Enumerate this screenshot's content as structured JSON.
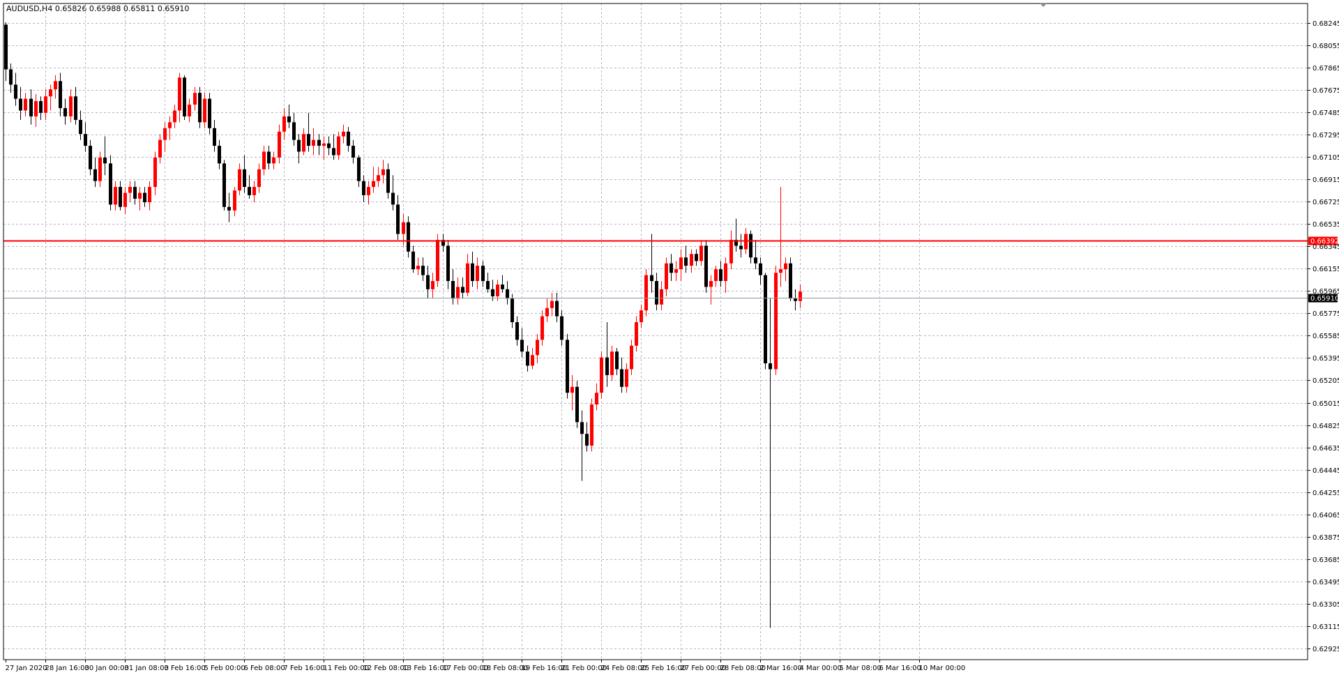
{
  "header": {
    "symbol": "AUDUSD,H4",
    "open": "0.65826",
    "high": "0.65988",
    "low": "0.65811",
    "close": "0.65910"
  },
  "colors": {
    "bull": "#ff0000",
    "bear": "#000000",
    "grid": "#b4b4c8",
    "level_line": "#ff0000",
    "bid_line": "#8c96a6"
  },
  "chart_data": {
    "type": "candlestick",
    "title": "AUDUSD,H4",
    "price_axis_ticks": [
      "0.68245",
      "0.68055",
      "0.67865",
      "0.67675",
      "0.67485",
      "0.67295",
      "0.67105",
      "0.66915",
      "0.66725",
      "0.66535",
      "0.66345",
      "0.66155",
      "0.65965",
      "0.65775",
      "0.65585",
      "0.65395",
      "0.65205",
      "0.65015",
      "0.64825",
      "0.64635",
      "0.64445",
      "0.64255",
      "0.64065",
      "0.63875",
      "0.63685",
      "0.63495",
      "0.63305",
      "0.63115",
      "0.62925"
    ],
    "time_axis_labels": [
      "27 Jan 2020",
      "28 Jan 16:00",
      "30 Jan 00:00",
      "31 Jan 08:00",
      "3 Feb 16:00",
      "5 Feb 00:00",
      "6 Feb 08:00",
      "7 Feb 16:00",
      "11 Feb 00:00",
      "12 Feb 08:00",
      "13 Feb 16:00",
      "17 Feb 00:00",
      "18 Feb 08:00",
      "19 Feb 16:00",
      "21 Feb 00:00",
      "24 Feb 08:00",
      "25 Feb 16:00",
      "27 Feb 00:00",
      "28 Feb 08:00",
      "2 Mar 16:00",
      "4 Mar 00:00",
      "5 Mar 08:00",
      "6 Mar 16:00",
      "10 Mar 00:00"
    ],
    "ylim": [
      0.6283,
      0.6841
    ],
    "horizontal_level": "0.66392",
    "bid_price": "0.65910",
    "grid": true,
    "candles": [
      [
        0.6823,
        0.6825,
        0.6775,
        0.6785
      ],
      [
        0.6785,
        0.679,
        0.6765,
        0.6772
      ],
      [
        0.6772,
        0.6782,
        0.6754,
        0.676
      ],
      [
        0.676,
        0.677,
        0.6742,
        0.675
      ],
      [
        0.675,
        0.6765,
        0.6745,
        0.676
      ],
      [
        0.676,
        0.6768,
        0.6738,
        0.6745
      ],
      [
        0.6745,
        0.6764,
        0.6736,
        0.6758
      ],
      [
        0.6758,
        0.6762,
        0.6742,
        0.6748
      ],
      [
        0.6748,
        0.6768,
        0.6742,
        0.6762
      ],
      [
        0.6762,
        0.6772,
        0.675,
        0.6768
      ],
      [
        0.6768,
        0.678,
        0.676,
        0.6775
      ],
      [
        0.6775,
        0.6782,
        0.6745,
        0.6752
      ],
      [
        0.6752,
        0.676,
        0.6738,
        0.6745
      ],
      [
        0.6745,
        0.6768,
        0.674,
        0.6762
      ],
      [
        0.6762,
        0.677,
        0.6738,
        0.6742
      ],
      [
        0.6742,
        0.675,
        0.6725,
        0.673
      ],
      [
        0.673,
        0.674,
        0.6715,
        0.672
      ],
      [
        0.672,
        0.6725,
        0.6695,
        0.67
      ],
      [
        0.67,
        0.671,
        0.6685,
        0.669
      ],
      [
        0.669,
        0.6715,
        0.6685,
        0.671
      ],
      [
        0.671,
        0.6728,
        0.6695,
        0.6705
      ],
      [
        0.6705,
        0.6712,
        0.6665,
        0.667
      ],
      [
        0.667,
        0.669,
        0.6665,
        0.6685
      ],
      [
        0.6685,
        0.669,
        0.6665,
        0.6668
      ],
      [
        0.6668,
        0.6685,
        0.6662,
        0.668
      ],
      [
        0.668,
        0.669,
        0.6672,
        0.6685
      ],
      [
        0.6685,
        0.669,
        0.667,
        0.6675
      ],
      [
        0.6675,
        0.6685,
        0.6665,
        0.668
      ],
      [
        0.668,
        0.6685,
        0.6668,
        0.6672
      ],
      [
        0.6672,
        0.669,
        0.6665,
        0.6685
      ],
      [
        0.6685,
        0.6715,
        0.6678,
        0.671
      ],
      [
        0.671,
        0.673,
        0.6705,
        0.6725
      ],
      [
        0.6725,
        0.674,
        0.6715,
        0.6735
      ],
      [
        0.6735,
        0.6745,
        0.6725,
        0.674
      ],
      [
        0.674,
        0.6755,
        0.6735,
        0.675
      ],
      [
        0.675,
        0.6782,
        0.674,
        0.6778
      ],
      [
        0.6778,
        0.678,
        0.6742,
        0.6745
      ],
      [
        0.6745,
        0.676,
        0.674,
        0.6755
      ],
      [
        0.6755,
        0.677,
        0.675,
        0.6765
      ],
      [
        0.6765,
        0.677,
        0.6735,
        0.674
      ],
      [
        0.674,
        0.6765,
        0.6735,
        0.676
      ],
      [
        0.676,
        0.6765,
        0.673,
        0.6735
      ],
      [
        0.6735,
        0.6742,
        0.6715,
        0.672
      ],
      [
        0.672,
        0.6725,
        0.67,
        0.6705
      ],
      [
        0.6705,
        0.6708,
        0.6665,
        0.6668
      ],
      [
        0.6668,
        0.668,
        0.6655,
        0.6665
      ],
      [
        0.6665,
        0.6685,
        0.666,
        0.6682
      ],
      [
        0.6682,
        0.6705,
        0.6678,
        0.67
      ],
      [
        0.67,
        0.6712,
        0.668,
        0.6685
      ],
      [
        0.6685,
        0.6695,
        0.6675,
        0.6678
      ],
      [
        0.6678,
        0.669,
        0.6672,
        0.6685
      ],
      [
        0.6685,
        0.6705,
        0.668,
        0.67
      ],
      [
        0.67,
        0.672,
        0.6695,
        0.6715
      ],
      [
        0.6715,
        0.672,
        0.67,
        0.6705
      ],
      [
        0.6705,
        0.6715,
        0.67,
        0.671
      ],
      [
        0.671,
        0.6738,
        0.6705,
        0.6732
      ],
      [
        0.6732,
        0.6752,
        0.6725,
        0.6745
      ],
      [
        0.6745,
        0.6755,
        0.6735,
        0.674
      ],
      [
        0.674,
        0.6748,
        0.672,
        0.6725
      ],
      [
        0.6725,
        0.673,
        0.6705,
        0.6715
      ],
      [
        0.6715,
        0.6735,
        0.6712,
        0.673
      ],
      [
        0.673,
        0.6748,
        0.6715,
        0.672
      ],
      [
        0.672,
        0.6735,
        0.6712,
        0.6725
      ],
      [
        0.6725,
        0.673,
        0.6712,
        0.672
      ],
      [
        0.672,
        0.6728,
        0.6708,
        0.6722
      ],
      [
        0.6722,
        0.6728,
        0.6712,
        0.6718
      ],
      [
        0.6718,
        0.673,
        0.6708,
        0.6712
      ],
      [
        0.6712,
        0.6732,
        0.6708,
        0.6728
      ],
      [
        0.6728,
        0.6738,
        0.6722,
        0.6732
      ],
      [
        0.6732,
        0.6736,
        0.6715,
        0.672
      ],
      [
        0.672,
        0.6725,
        0.6705,
        0.671
      ],
      [
        0.671,
        0.6712,
        0.6685,
        0.669
      ],
      [
        0.669,
        0.6695,
        0.6672,
        0.6678
      ],
      [
        0.6678,
        0.669,
        0.667,
        0.6685
      ],
      [
        0.6685,
        0.6702,
        0.668,
        0.669
      ],
      [
        0.669,
        0.6702,
        0.6685,
        0.6695
      ],
      [
        0.6695,
        0.6708,
        0.6688,
        0.67
      ],
      [
        0.67,
        0.6705,
        0.6675,
        0.668
      ],
      [
        0.668,
        0.6695,
        0.6665,
        0.667
      ],
      [
        0.667,
        0.6678,
        0.664,
        0.6645
      ],
      [
        0.6645,
        0.6662,
        0.6635,
        0.6655
      ],
      [
        0.6655,
        0.666,
        0.6625,
        0.663
      ],
      [
        0.663,
        0.6635,
        0.6612,
        0.6615
      ],
      [
        0.6615,
        0.6625,
        0.661,
        0.6618
      ],
      [
        0.6618,
        0.6625,
        0.6605,
        0.661
      ],
      [
        0.661,
        0.6618,
        0.659,
        0.6598
      ],
      [
        0.6598,
        0.6612,
        0.659,
        0.6605
      ],
      [
        0.6605,
        0.6645,
        0.66,
        0.664
      ],
      [
        0.664,
        0.6645,
        0.663,
        0.6635
      ],
      [
        0.6635,
        0.664,
        0.6598,
        0.6605
      ],
      [
        0.6605,
        0.6615,
        0.6585,
        0.659
      ],
      [
        0.659,
        0.6608,
        0.6585,
        0.66
      ],
      [
        0.66,
        0.6608,
        0.659,
        0.6595
      ],
      [
        0.6595,
        0.6628,
        0.6592,
        0.662
      ],
      [
        0.662,
        0.663,
        0.66,
        0.6605
      ],
      [
        0.6605,
        0.6625,
        0.6598,
        0.6618
      ],
      [
        0.6618,
        0.6622,
        0.66,
        0.6605
      ],
      [
        0.6605,
        0.6612,
        0.6595,
        0.6598
      ],
      [
        0.6598,
        0.6606,
        0.6588,
        0.6592
      ],
      [
        0.6592,
        0.6606,
        0.6588,
        0.6602
      ],
      [
        0.6602,
        0.661,
        0.6595,
        0.6598
      ],
      [
        0.6598,
        0.6605,
        0.6585,
        0.659
      ],
      [
        0.659,
        0.6594,
        0.6565,
        0.657
      ],
      [
        0.657,
        0.6575,
        0.655,
        0.6555
      ],
      [
        0.6555,
        0.6565,
        0.654,
        0.6545
      ],
      [
        0.6545,
        0.655,
        0.6528,
        0.6533
      ],
      [
        0.6533,
        0.6548,
        0.653,
        0.6542
      ],
      [
        0.6542,
        0.656,
        0.6535,
        0.6555
      ],
      [
        0.6555,
        0.658,
        0.655,
        0.6575
      ],
      [
        0.6575,
        0.659,
        0.657,
        0.6582
      ],
      [
        0.6582,
        0.6595,
        0.6575,
        0.6588
      ],
      [
        0.6588,
        0.6595,
        0.657,
        0.6575
      ],
      [
        0.6575,
        0.658,
        0.655,
        0.6555
      ],
      [
        0.6555,
        0.656,
        0.6505,
        0.651
      ],
      [
        0.651,
        0.6525,
        0.6495,
        0.6515
      ],
      [
        0.6515,
        0.652,
        0.648,
        0.6485
      ],
      [
        0.6485,
        0.6495,
        0.6435,
        0.6475
      ],
      [
        0.6475,
        0.6485,
        0.646,
        0.6465
      ],
      [
        0.6465,
        0.6505,
        0.646,
        0.65
      ],
      [
        0.65,
        0.6518,
        0.6495,
        0.651
      ],
      [
        0.651,
        0.6545,
        0.6505,
        0.654
      ],
      [
        0.654,
        0.657,
        0.6515,
        0.6525
      ],
      [
        0.6525,
        0.655,
        0.652,
        0.6545
      ],
      [
        0.6545,
        0.6548,
        0.6525,
        0.653
      ],
      [
        0.653,
        0.654,
        0.651,
        0.6515
      ],
      [
        0.6515,
        0.6535,
        0.651,
        0.653
      ],
      [
        0.653,
        0.6555,
        0.6525,
        0.655
      ],
      [
        0.655,
        0.6575,
        0.6545,
        0.657
      ],
      [
        0.657,
        0.6585,
        0.6565,
        0.658
      ],
      [
        0.658,
        0.6615,
        0.6575,
        0.661
      ],
      [
        0.661,
        0.6645,
        0.6595,
        0.6605
      ],
      [
        0.6605,
        0.6612,
        0.658,
        0.6585
      ],
      [
        0.6585,
        0.6605,
        0.658,
        0.6598
      ],
      [
        0.6598,
        0.6625,
        0.6592,
        0.662
      ],
      [
        0.662,
        0.6628,
        0.6605,
        0.6612
      ],
      [
        0.6612,
        0.6622,
        0.6605,
        0.6615
      ],
      [
        0.6615,
        0.6632,
        0.6605,
        0.6625
      ],
      [
        0.6625,
        0.6635,
        0.6612,
        0.6618
      ],
      [
        0.6618,
        0.6632,
        0.6612,
        0.6628
      ],
      [
        0.6628,
        0.6632,
        0.6618,
        0.6622
      ],
      [
        0.6622,
        0.664,
        0.6618,
        0.6635
      ],
      [
        0.6635,
        0.664,
        0.6595,
        0.66
      ],
      [
        0.66,
        0.661,
        0.6585,
        0.6605
      ],
      [
        0.6605,
        0.6618,
        0.66,
        0.6615
      ],
      [
        0.6615,
        0.6622,
        0.66,
        0.6605
      ],
      [
        0.6605,
        0.6625,
        0.6595,
        0.662
      ],
      [
        0.662,
        0.6648,
        0.6615,
        0.664
      ],
      [
        0.664,
        0.6658,
        0.663,
        0.6635
      ],
      [
        0.6635,
        0.6645,
        0.6625,
        0.6632
      ],
      [
        0.6632,
        0.665,
        0.6628,
        0.6645
      ],
      [
        0.6645,
        0.6648,
        0.662,
        0.6625
      ],
      [
        0.6625,
        0.664,
        0.6615,
        0.662
      ],
      [
        0.662,
        0.6625,
        0.6602,
        0.661
      ],
      [
        0.661,
        0.6612,
        0.653,
        0.6535
      ],
      [
        0.6535,
        0.659,
        0.631,
        0.653
      ],
      [
        0.653,
        0.6618,
        0.6525,
        0.6612
      ],
      [
        0.6612,
        0.6685,
        0.66,
        0.6615
      ],
      [
        0.6615,
        0.6625,
        0.6605,
        0.662
      ],
      [
        0.662,
        0.6625,
        0.6588,
        0.659
      ],
      [
        0.659,
        0.6598,
        0.658,
        0.6588
      ],
      [
        0.6588,
        0.6602,
        0.6582,
        0.6596
      ]
    ]
  }
}
